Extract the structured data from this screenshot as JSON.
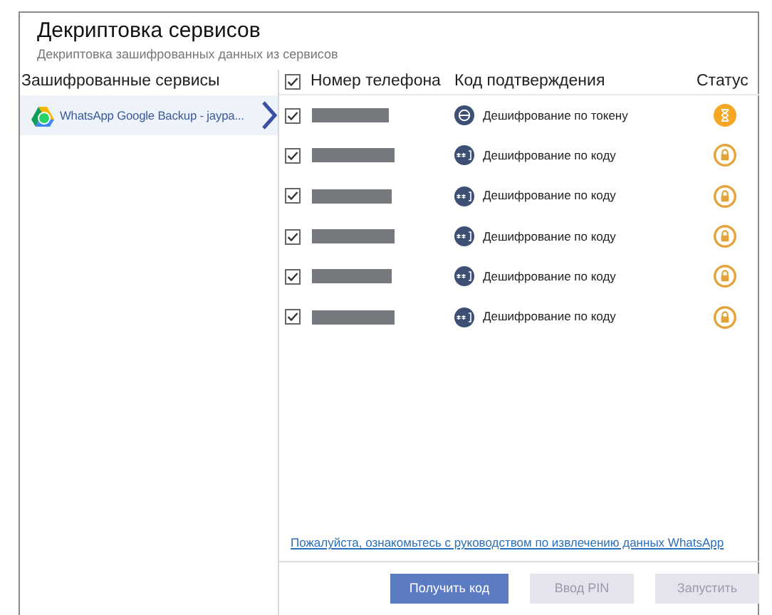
{
  "window": {
    "title": "Декриптовка сервисов",
    "subtitle": "Декриптовка зашифрованных данных из сервисов"
  },
  "services": {
    "header": "Зашифрованные сервисы",
    "items": [
      {
        "label": "WhatsApp Google Backup - jaypa...",
        "selected": true
      }
    ]
  },
  "table": {
    "select_all_checked": true,
    "columns": [
      "Номер телефона",
      "Код подтверждения",
      "Статус"
    ],
    "rows": [
      {
        "checked": true,
        "kind": "token",
        "method": "Дешифрование по токену",
        "pending": true
      },
      {
        "checked": true,
        "kind": "code",
        "method": "Дешифрование по коду",
        "pending": false
      },
      {
        "checked": true,
        "kind": "code",
        "method": "Дешифрование по коду",
        "pending": false
      },
      {
        "checked": true,
        "kind": "code",
        "method": "Дешифрование по коду",
        "pending": false
      },
      {
        "checked": true,
        "kind": "code",
        "method": "Дешифрование по коду",
        "pending": false
      },
      {
        "checked": true,
        "kind": "code",
        "method": "Дешифрование по коду",
        "pending": false
      }
    ]
  },
  "guide_link": "Пожалуйста, ознакомьтесь с руководством по извлечению данных WhatsApp",
  "buttons": [
    {
      "label": "Получить код",
      "disabled": false
    },
    {
      "label": "Ввод PIN",
      "disabled": true
    },
    {
      "label": "Запустить",
      "disabled": true
    }
  ]
}
